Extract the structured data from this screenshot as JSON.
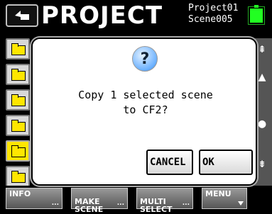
{
  "header": {
    "title": "PROJECT",
    "project_name": "Project01",
    "scene_name": "Scene005"
  },
  "dialog": {
    "icon": "question-icon",
    "message": "Copy 1 selected scene\nto CF2?",
    "cancel_label": "CANCEL",
    "ok_label": "OK"
  },
  "bottombar": {
    "info_label": "INFO",
    "make_scene_label": "MAKE\nSCENE",
    "multi_select_label": "MULTI\nSELECT",
    "menu_label": "MENU"
  },
  "colors": {
    "accent_yellow": "#ffe600",
    "battery_green": "#22ff22",
    "dialog_bg": "#ffffff"
  }
}
